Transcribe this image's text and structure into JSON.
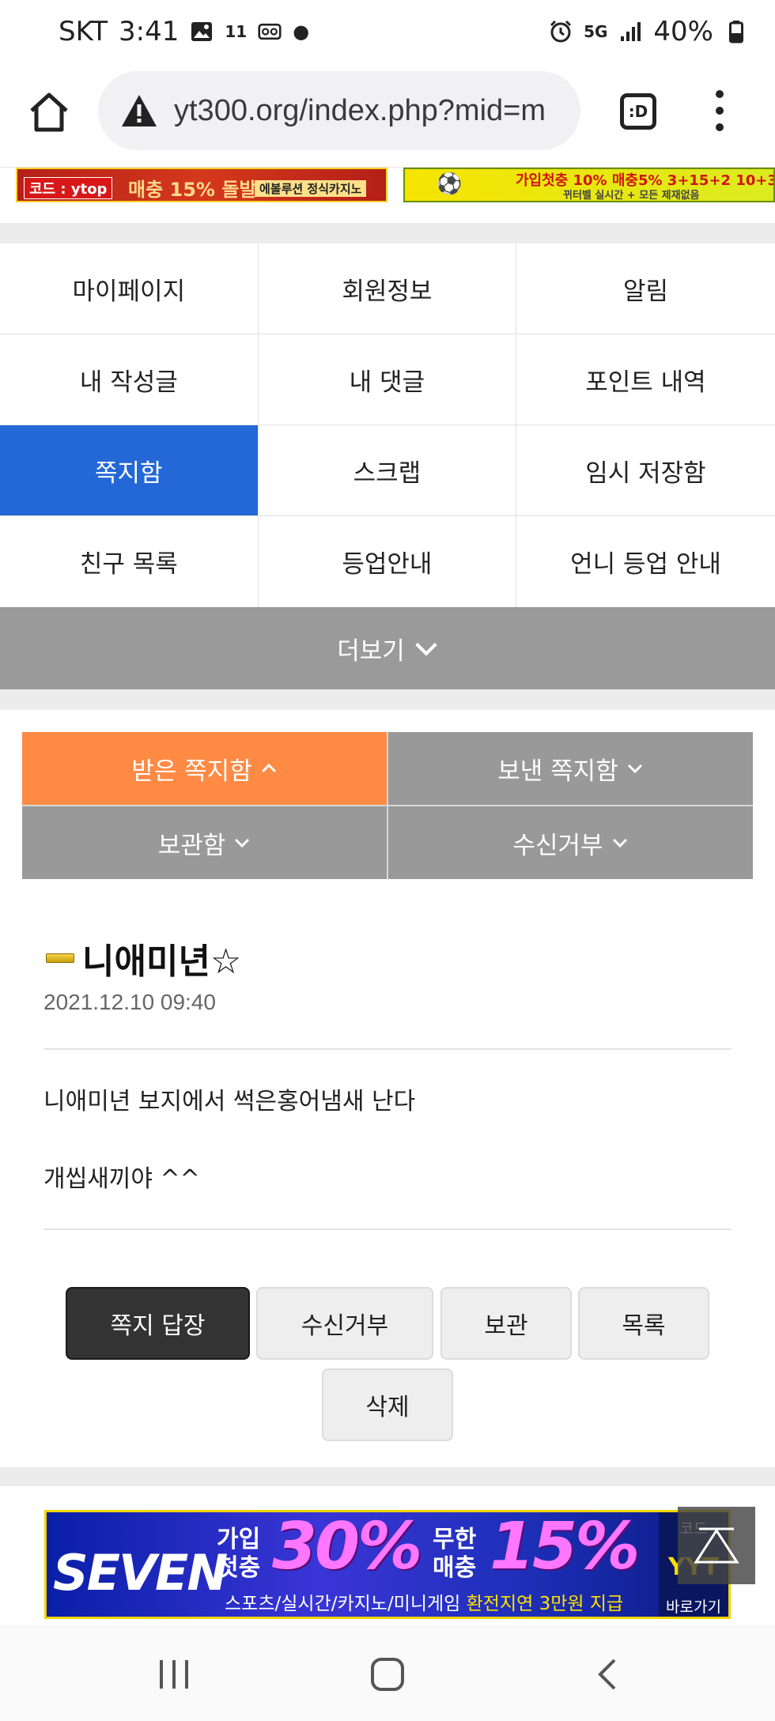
{
  "status_bar": {
    "carrier": "SKT",
    "time": "3:41",
    "notif_badge": "11",
    "network": "5G",
    "battery": "40%"
  },
  "browser": {
    "url": "yt300.org/index.php?mid=m",
    "tabs_label": ":D"
  },
  "top_banners": {
    "left_code": "코드 : ytop",
    "left_promo": "매충 15% 돌발20%",
    "left_tag": "에볼루션 정식카지노",
    "right_promo": "가입첫충 10% 매충5% 3+15+2 10+3",
    "right_sub": "뀌터벨 실시간 + 모든 제재없음"
  },
  "mypage_menu": {
    "rows": [
      [
        "마이페이지",
        "회원정보",
        "알림"
      ],
      [
        "내 작성글",
        "내 댓글",
        "포인트 내역"
      ],
      [
        "쪽지함",
        "스크랩",
        "임시 저장함"
      ],
      [
        "친구 목록",
        "등업안내",
        "언니 등업 안내"
      ]
    ],
    "active": "쪽지함",
    "more_label": "더보기"
  },
  "message_tabs": {
    "received": "받은 쪽지함",
    "sent": "보낸 쪽지함",
    "stored": "보관함",
    "blocked": "수신거부"
  },
  "message": {
    "sender": "니애미년☆",
    "date": "2021.12.10 09:40",
    "line1": "니애미년 보지에서 썩은홍어냄새 난다",
    "line2": "개씹새끼야 ^^"
  },
  "actions": {
    "reply": "쪽지 답장",
    "block": "수신거부",
    "store": "보관",
    "list": "목록",
    "delete": "삭제"
  },
  "bottom_banner": {
    "brand": "SEVEN",
    "signup": "가입",
    "first": "첫충",
    "pct1": "30%",
    "unlimited": "무한",
    "reload": "매충",
    "pct2": "15%",
    "sub": "스포츠/실시간/카지노/미니게임",
    "sub_highlight": "환전지연 3만원 지급",
    "code_label": "코드",
    "code": "YYT",
    "go_label": "바로가기"
  }
}
